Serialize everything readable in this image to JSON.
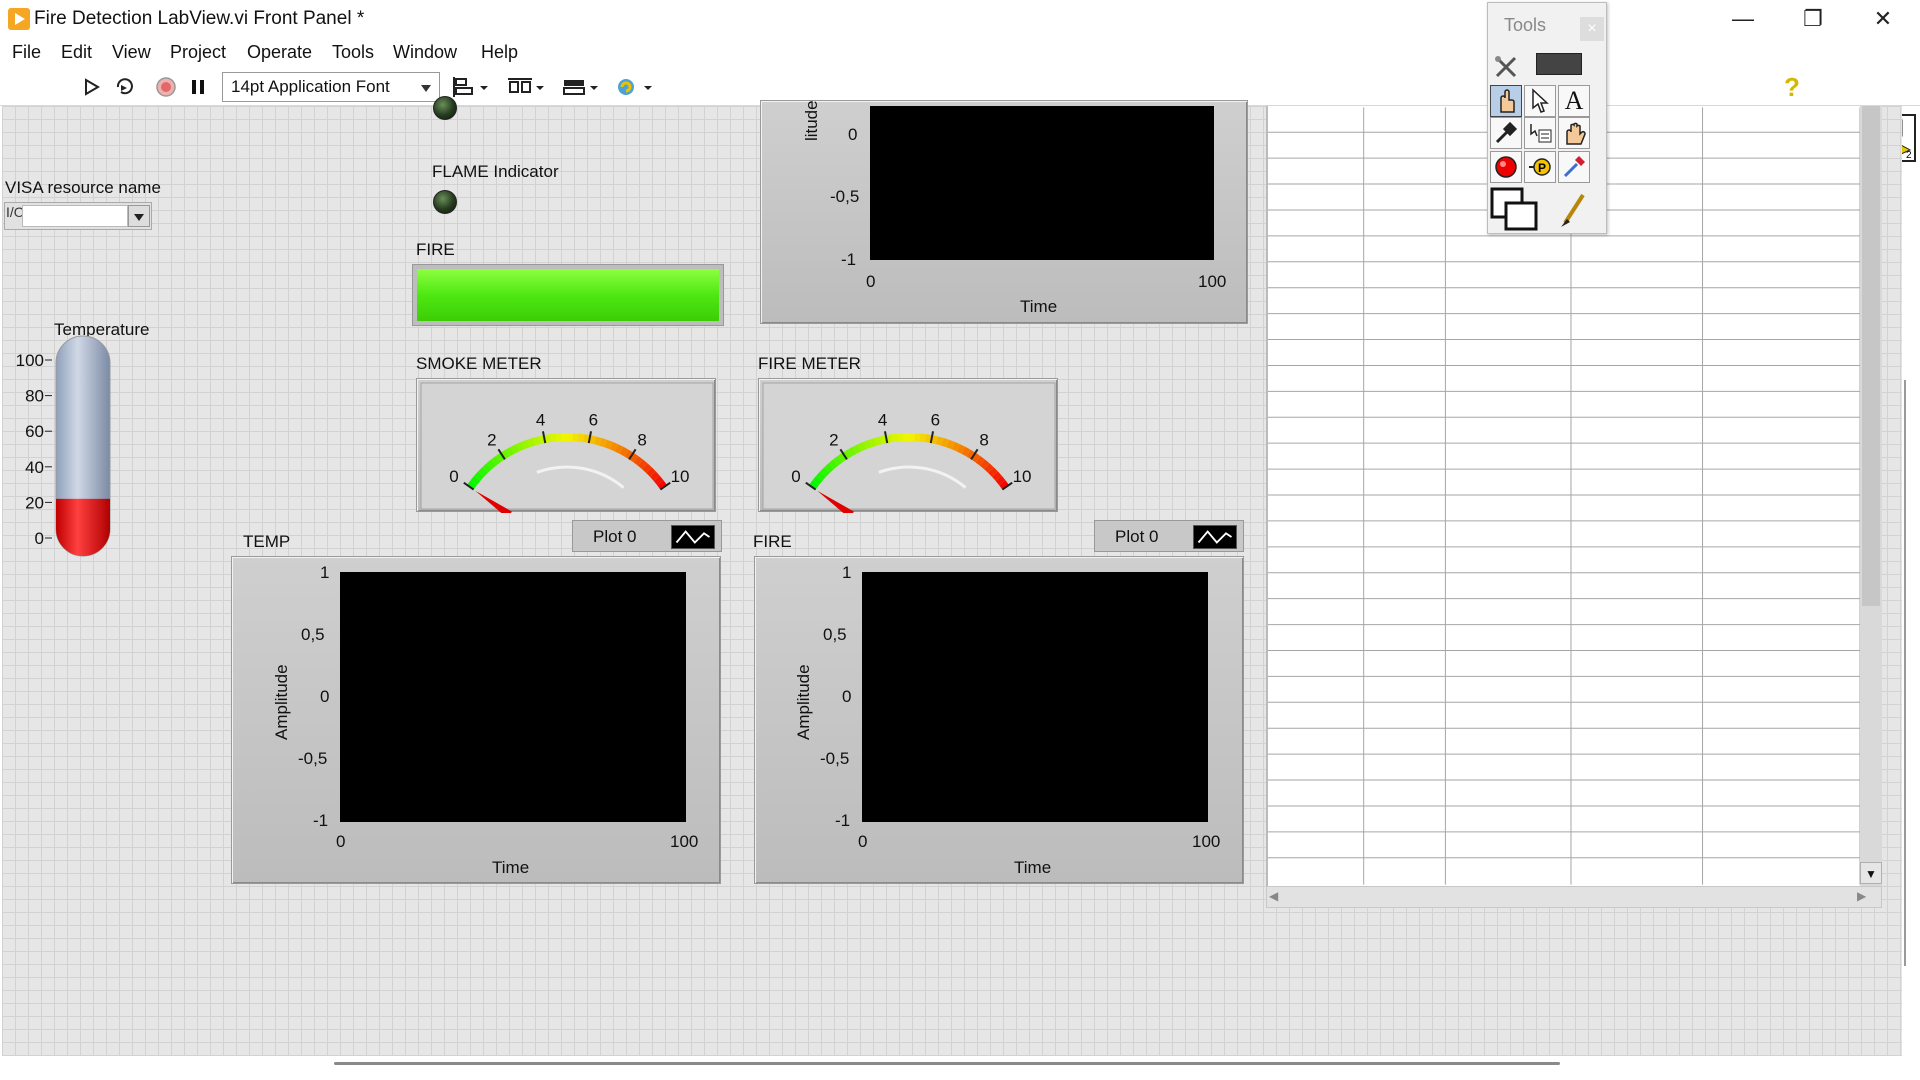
{
  "window": {
    "title": "Fire Detection LabView.vi Front Panel *",
    "minimize": "—",
    "restore": "❐",
    "close": "✕"
  },
  "menu": [
    "File",
    "Edit",
    "View",
    "Project",
    "Operate",
    "Tools",
    "Window",
    "Help"
  ],
  "toolbar": {
    "font": "14pt Application Font",
    "icons": [
      "run-arrow-icon",
      "run-continuously-icon",
      "abort-icon",
      "pause-icon",
      "align-icon",
      "distribute-icon",
      "resize-icon",
      "reorder-icon",
      "help-icon",
      "grid-icon",
      "vi-icon"
    ]
  },
  "controls": {
    "visa_label": "VISA resource name",
    "visa_value": "",
    "flame_label": "FLAME Indicator",
    "fire_label": "FIRE",
    "fire_on": true,
    "temperature": {
      "label": "Temperature",
      "ticks": [
        "100",
        "80",
        "60",
        "40",
        "20",
        "0"
      ],
      "value": 22
    },
    "smoke_meter": {
      "label": "SMOKE METER",
      "ticks": [
        "0",
        "2",
        "4",
        "6",
        "8",
        "10"
      ],
      "value": 0
    },
    "fire_meter": {
      "label": "FIRE METER",
      "ticks": [
        "0",
        "2",
        "4",
        "6",
        "8",
        "10"
      ],
      "value": 0
    }
  },
  "charts": {
    "top": {
      "y_ticks": [
        "0",
        "-0,5",
        "-1"
      ],
      "x_ticks": [
        "0",
        "100"
      ],
      "xlabel": "Time",
      "ylabel": "Amplitude"
    },
    "temp": {
      "label": "TEMP",
      "legend": "Plot 0",
      "y_ticks": [
        "1",
        "0,5",
        "0",
        "-0,5",
        "-1"
      ],
      "x_ticks": [
        "0",
        "100"
      ],
      "xlabel": "Time",
      "ylabel": "Amplitude"
    },
    "fire": {
      "label": "FIRE",
      "legend": "Plot 0",
      "y_ticks": [
        "1",
        "0,5",
        "0",
        "-0,5",
        "-1"
      ],
      "x_ticks": [
        "0",
        "100"
      ],
      "xlabel": "Time",
      "ylabel": "Amplitude"
    }
  },
  "tools_palette": {
    "title": "Tools",
    "close": "×",
    "tools": [
      "automatic-tool-icon",
      "operate-value-icon",
      "position-select-icon",
      "edit-text-icon",
      "connect-wire-icon",
      "object-shortcut-icon",
      "scroll-window-icon",
      "breakpoint-icon",
      "probe-icon",
      "get-color-icon",
      "set-color-icon",
      "paintbrush-icon"
    ]
  }
}
